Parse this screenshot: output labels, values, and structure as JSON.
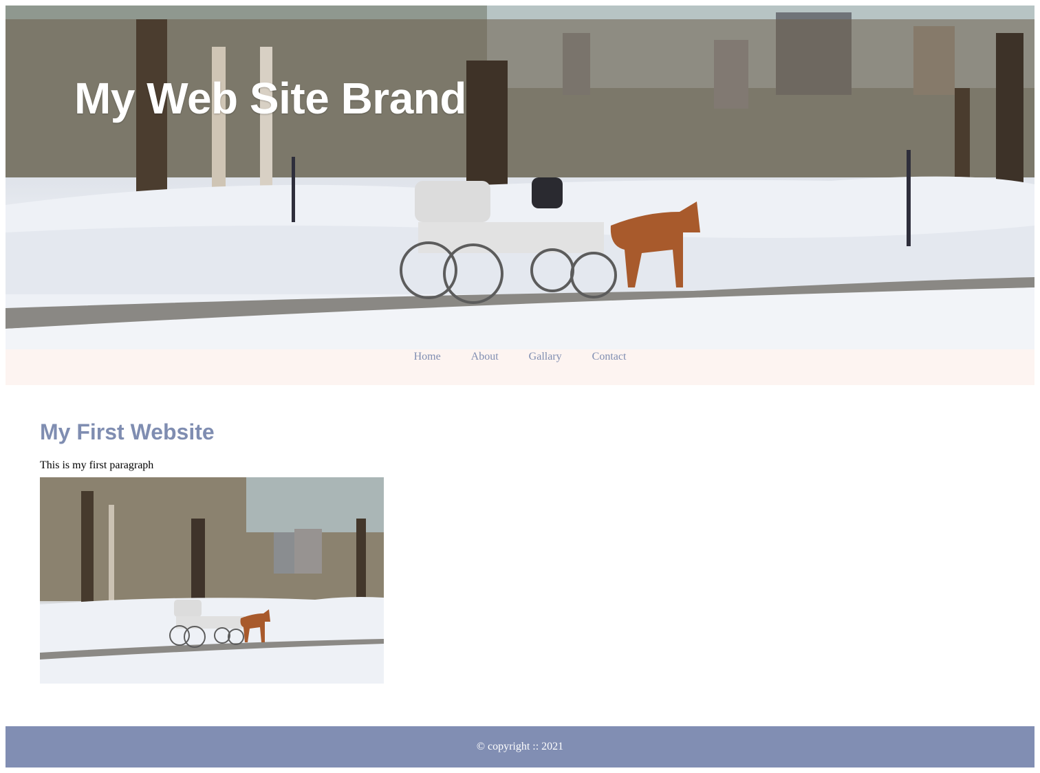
{
  "header": {
    "brand": "My Web Site Brand",
    "hero_image": "winter-park-horse-carriage-photo"
  },
  "nav": {
    "items": [
      {
        "label": "Home"
      },
      {
        "label": "About"
      },
      {
        "label": "Gallary"
      },
      {
        "label": "Contact"
      }
    ]
  },
  "main": {
    "heading": "My First Website",
    "paragraph": "This is my first paragraph",
    "image": "winter-park-horse-carriage-photo"
  },
  "footer": {
    "text": "© copyright :: 2021"
  },
  "colors": {
    "accent": "#818eb3",
    "nav_background": "#fdf4f1",
    "link": "#7f8db1"
  }
}
